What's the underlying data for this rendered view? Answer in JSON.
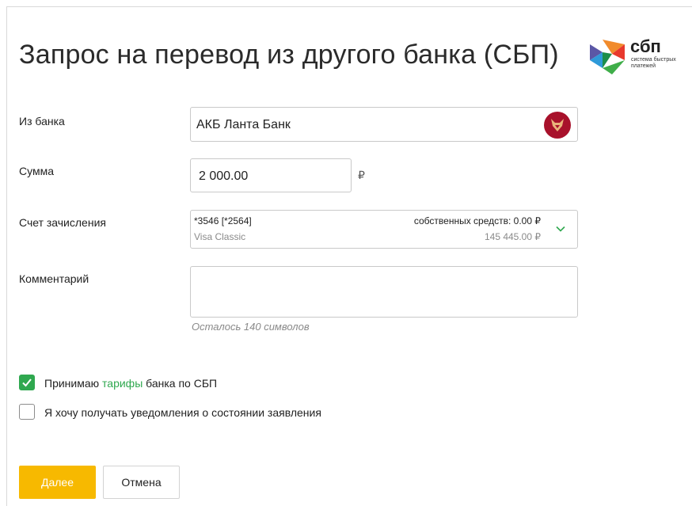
{
  "page": {
    "title": "Запрос на перевод из другого банка (СБП)"
  },
  "logo": {
    "word": "сбп",
    "subtitle": "система быстрых платежей",
    "icon": "sbp-logo-icon"
  },
  "form": {
    "from_bank": {
      "label": "Из банка",
      "value": "АКБ Ланта Банк",
      "icon": "bank-logo-icon"
    },
    "amount": {
      "label": "Сумма",
      "value": "2 000.00",
      "currency": "₽"
    },
    "account": {
      "label": "Счет зачисления",
      "number": "*3546 [*2564]",
      "type": "Visa Classic",
      "own_funds": "собственных средств: 0.00 ₽",
      "balance": "145 445.00 ₽",
      "icon": "chevron-down-icon"
    },
    "comment": {
      "label": "Комментарий",
      "value": "",
      "remaining": "Осталось 140 символов"
    }
  },
  "checkboxes": {
    "tariffs": {
      "checked": true,
      "prefix": "Принимаю ",
      "link": "тарифы",
      "suffix": " банка по СБП"
    },
    "notifications": {
      "checked": false,
      "label": "Я хочу получать уведомления о состоянии заявления"
    }
  },
  "buttons": {
    "next": "Далее",
    "cancel": "Отмена"
  },
  "colors": {
    "accent_green": "#2fa84f",
    "primary_button": "#f7b900",
    "bank_logo": "#a8112b"
  }
}
